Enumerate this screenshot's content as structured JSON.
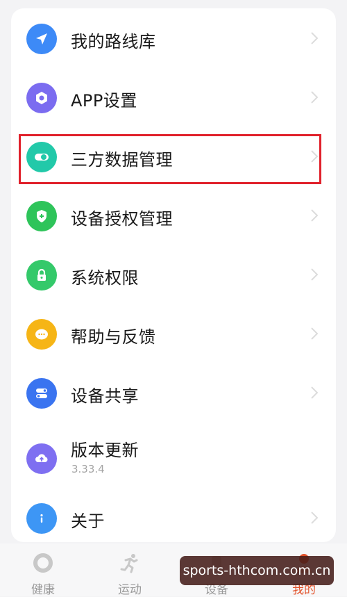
{
  "menu": {
    "items": [
      {
        "label": "我的路线库",
        "icon": "navigation-arrow-icon",
        "color": "#3d8af7"
      },
      {
        "label": "APP设置",
        "icon": "settings-hexagon-icon",
        "color": "#7b6cf0"
      },
      {
        "label": "三方数据管理",
        "icon": "toggle-link-icon",
        "color": "#22c9a9",
        "highlighted": true
      },
      {
        "label": "设备授权管理",
        "icon": "shield-plus-icon",
        "color": "#2ec45a"
      },
      {
        "label": "系统权限",
        "icon": "lock-icon",
        "color": "#34c96a"
      },
      {
        "label": "帮助与反馈",
        "icon": "chat-bubble-icon",
        "color": "#f6b516"
      },
      {
        "label": "设备共享",
        "icon": "share-toggle-icon",
        "color": "#3a74f0"
      },
      {
        "label": "版本更新",
        "sublabel": "3.33.4",
        "icon": "cloud-upload-icon",
        "color": "#7e6ff1"
      },
      {
        "label": "关于",
        "icon": "info-icon",
        "color": "#3d96f5"
      }
    ]
  },
  "tabbar": {
    "tabs": [
      {
        "label": "健康",
        "icon": "health-ring-icon"
      },
      {
        "label": "运动",
        "icon": "running-figure-icon"
      },
      {
        "label": "设备",
        "icon": "watch-icon"
      },
      {
        "label": "我的",
        "icon": "profile-icon",
        "active": true
      }
    ],
    "active_color": "#e2522a"
  },
  "highlight_color": "#e0212b",
  "watermark": {
    "text": "sports-hthcom.com.cn"
  }
}
